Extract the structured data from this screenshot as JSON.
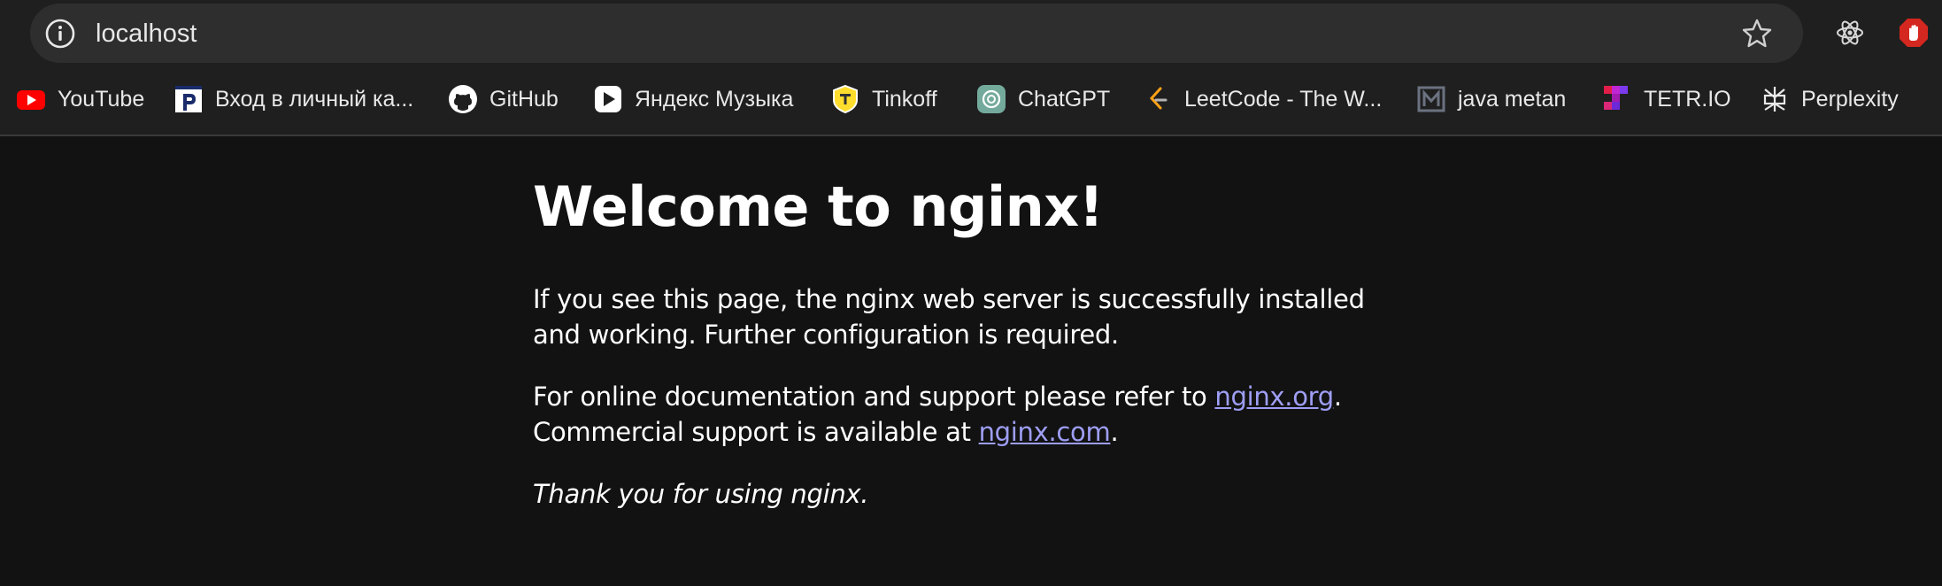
{
  "browser": {
    "url": "localhost",
    "extensions": [
      "react-devtools-icon",
      "hand-stop-icon"
    ]
  },
  "bookmarks": [
    {
      "label": "YouTube",
      "icon": "youtube-icon",
      "color": "#ff0000"
    },
    {
      "label": "Вход в личный ка...",
      "icon": "p-logo-icon",
      "color": "#ffffff"
    },
    {
      "label": "GitHub",
      "icon": "github-icon",
      "color": "#ffffff"
    },
    {
      "label": "Яндекс Музыка",
      "icon": "play-icon",
      "color": "#ffffff"
    },
    {
      "label": "Tinkoff",
      "icon": "tinkoff-shield-icon",
      "color": "#ffdd2d"
    },
    {
      "label": "ChatGPT",
      "icon": "chatgpt-icon",
      "color": "#74aa9c"
    },
    {
      "label": "LeetCode - The W...",
      "icon": "leetcode-icon",
      "color": "#ffa116"
    },
    {
      "label": "java metan",
      "icon": "m-logo-icon",
      "color": "#6b7280"
    },
    {
      "label": "TETR.IO",
      "icon": "tetrio-icon",
      "color": "#c026d3"
    },
    {
      "label": "Perplexity",
      "icon": "perplexity-icon",
      "color": "#ffffff"
    }
  ],
  "page": {
    "title": "Welcome to nginx!",
    "p1": "If you see this page, the nginx web server is successfully installed and working. Further configuration is required.",
    "p2_before": "For online documentation and support please refer to ",
    "link1": "nginx.org",
    "p2_mid": ".",
    "p2_line2": "Commercial support is available at ",
    "link2": "nginx.com",
    "p2_end": ".",
    "p3": "Thank you for using nginx.",
    "link_color": "#9e9ef5"
  }
}
